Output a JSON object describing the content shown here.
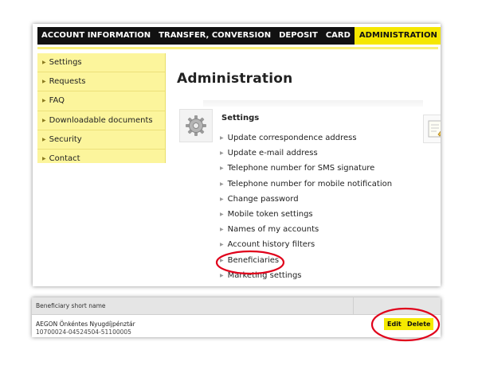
{
  "nav": {
    "items": [
      "ACCOUNT INFORMATION",
      "TRANSFER, CONVERSION",
      "DEPOSIT",
      "CARD"
    ],
    "active": "ADMINISTRATION"
  },
  "sidebar": {
    "items": [
      "Settings",
      "Requests",
      "FAQ",
      "Downloadable documents",
      "Security",
      "Contact"
    ]
  },
  "page": {
    "title": "Administration"
  },
  "settings": {
    "title": "Settings",
    "links": [
      "Update correspondence address",
      "Update e-mail address",
      "Telephone number for SMS signature",
      "Telephone number for mobile notification",
      "Change password",
      "Mobile token settings",
      "Names of my accounts",
      "Account history filters",
      "Beneficiaries",
      "Marketing settings"
    ]
  },
  "beneficiaries": {
    "column_header": "Beneficiary short name",
    "row": {
      "name": "AEGON Önkéntes Nyugdíjpénztár",
      "account": "10700024-04524504-51100005"
    },
    "edit_label": "Edit",
    "delete_label": "Delete"
  },
  "icons": {
    "bullet": "triangle-right-icon",
    "settings": "gear-icon",
    "other": "document-pencil-icon"
  },
  "colors": {
    "accent": "#f5e700",
    "sidebar": "#fcf59c",
    "nav": "#111111",
    "highlight": "#e0001a"
  }
}
